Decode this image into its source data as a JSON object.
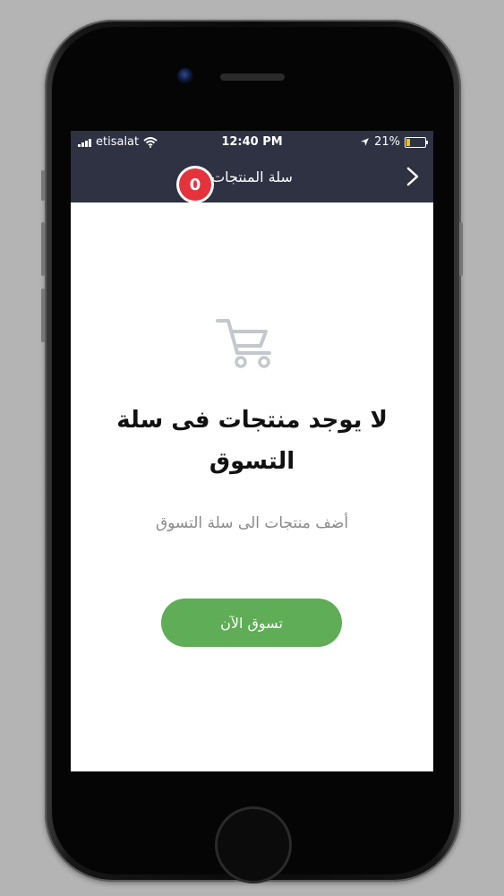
{
  "status_bar": {
    "carrier": "etisalat",
    "time": "12:40 PM",
    "battery_percent": "21%",
    "battery_level": 0.21,
    "icons": [
      "signal-icon",
      "wifi-icon",
      "location-arrow-icon",
      "battery-icon"
    ]
  },
  "nav": {
    "title": "سلة المنتجات",
    "back_icon": "chevron-right-icon"
  },
  "cart": {
    "icon": "shopping-cart-icon",
    "badge_count": "0",
    "badge_color": "#e5333c"
  },
  "empty_state": {
    "title": "لا يوجد منتجات فى سلة التسوق",
    "subtitle": "أضف منتجات الى سلة التسوق"
  },
  "actions": {
    "shop_now_label": "تسوق الآن",
    "button_color": "#5fad56"
  },
  "theme": {
    "header_color": "#2e3243"
  }
}
